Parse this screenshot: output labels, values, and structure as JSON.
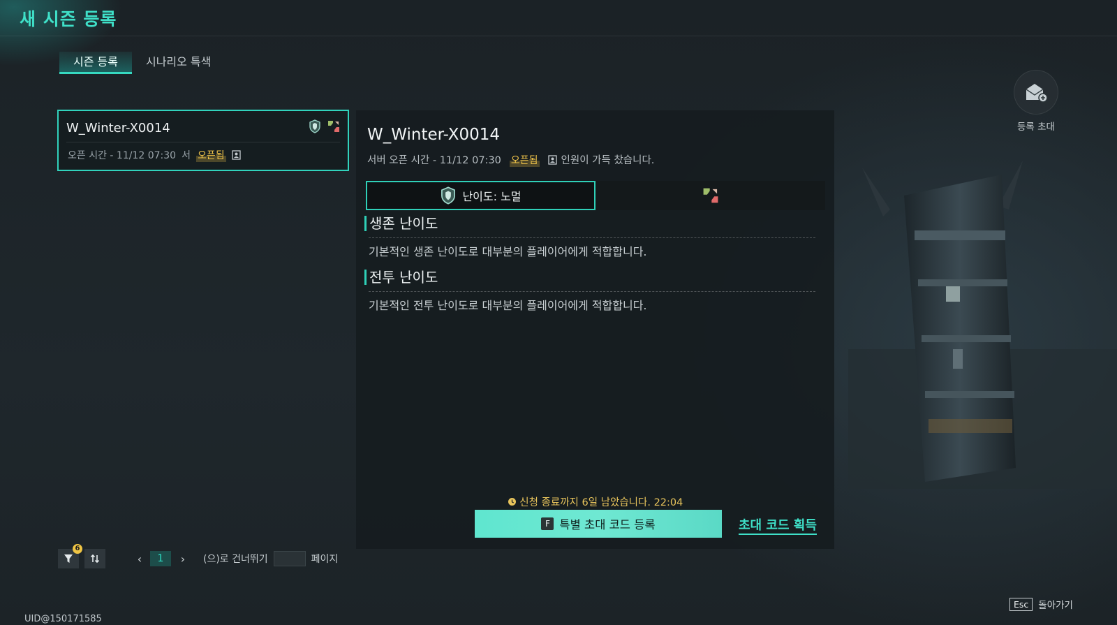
{
  "page": {
    "title": "새 시즌 등록"
  },
  "tabs": [
    {
      "label": "시즌 등록"
    },
    {
      "label": "시나리오 특색"
    }
  ],
  "season_list": [
    {
      "name": "W_Winter-X0014",
      "open_time": "오픈 시간 - 11/12 07:30",
      "server_suffix": "서",
      "status": "오픈됨"
    }
  ],
  "detail": {
    "title": "W_Winter-X0014",
    "open_time": "서버 오픈 시간 - 11/12 07:30",
    "status": "오픈됨",
    "capacity_text": "인원이 가득 찼습니다.",
    "difficulty_tab": "난이도: 노멀",
    "sections": [
      {
        "heading": "생존 난이도",
        "description": "기본적인 생존 난이도로 대부분의 플레이어에게 적합합니다."
      },
      {
        "heading": "전투 난이도",
        "description": "기본적인 전투 난이도로 대부분의 플레이어에게 적합합니다."
      }
    ],
    "deadline": "신청 종료까지 6일 남았습니다. 22:04",
    "register_key": "F",
    "register_label": "특별 초대 코드 등록",
    "code_link": "초대 코드 획득"
  },
  "invite": {
    "label": "등록 초대"
  },
  "pagination": {
    "filter_count": "6",
    "current_page": "1",
    "skip_label": "(으)로 건너뛰기",
    "page_label": "페이지"
  },
  "footer": {
    "uid": "UID@150171585",
    "esc_key": "Esc",
    "back_label": "돌아가기"
  },
  "colors": {
    "accent": "#3fe0c8",
    "open_badge": "#f3c64a",
    "button_fill": "#6fe8d2"
  }
}
